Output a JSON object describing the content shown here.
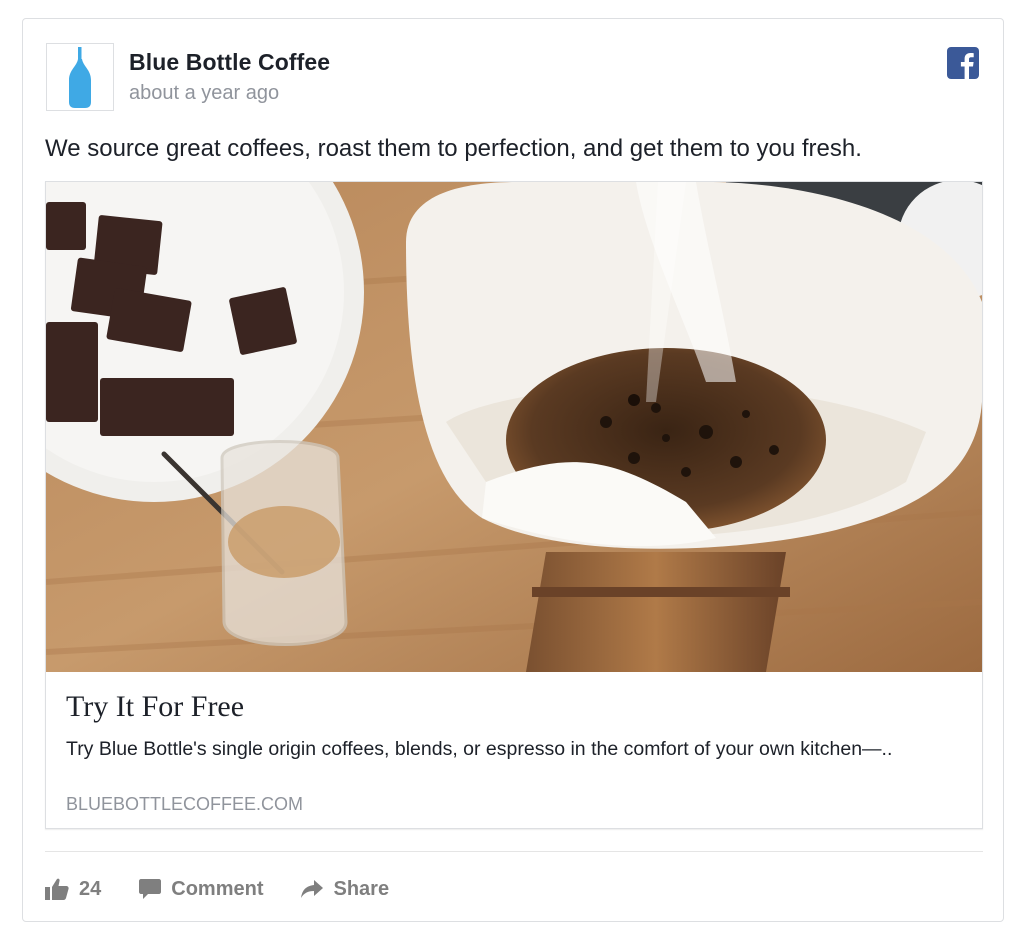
{
  "post": {
    "page_name": "Blue Bottle Coffee",
    "timestamp": "about a year ago",
    "text": "We source great coffees, roast them to perfection, and get them to you fresh.",
    "social_icon": "facebook-icon",
    "avatar_icon": "blue-bottle-logo"
  },
  "link": {
    "title": "Try It For Free",
    "description": "Try Blue Bottle's single origin coffees, blends, or espresso in the comfort of your own kitchen—..",
    "domain": "BLUEBOTTLECOFFEE.COM",
    "image_icon": "pour-over-coffee-photo"
  },
  "actions": {
    "like_count": "24",
    "comment_label": "Comment",
    "share_label": "Share"
  },
  "colors": {
    "facebook_blue": "#3b5998",
    "brand_blue": "#3fa9e5",
    "muted_text": "#90949c",
    "action_gray": "#7f7f7f"
  }
}
